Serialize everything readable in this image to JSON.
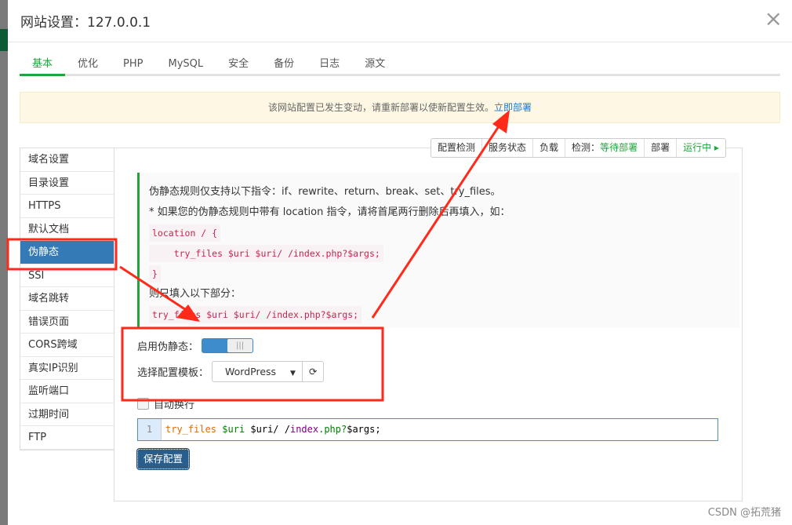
{
  "dialog": {
    "title": "网站设置：127.0.0.1",
    "close": "×"
  },
  "tabs": [
    {
      "label": "基本",
      "active": true
    },
    {
      "label": "优化"
    },
    {
      "label": "PHP"
    },
    {
      "label": "MySQL"
    },
    {
      "label": "安全"
    },
    {
      "label": "备份"
    },
    {
      "label": "日志"
    },
    {
      "label": "源文"
    }
  ],
  "notice": {
    "text": "该网站配置已发生变动，请重新部署以使新配置生效。",
    "link": "立即部署"
  },
  "sidebar": [
    "域名设置",
    "目录设置",
    "HTTPS",
    "默认文档",
    "伪静态",
    "SSI",
    "域名跳转",
    "错误页面",
    "CORS跨域",
    "真实IP识别",
    "监听端口",
    "过期时间",
    "FTP"
  ],
  "sidebar_active": "伪静态",
  "toolbar": {
    "check": "配置检测",
    "service": "服务状态",
    "load": "负载",
    "detect_label": "检测：",
    "detect_value": "等待部署",
    "deploy": "部署",
    "running": "运行中 ▸"
  },
  "info": {
    "line1": "伪静态规则仅支持以下指令：if、rewrite、return、break、set、try_files。",
    "line2": "* 如果您的伪静态规则中带有 location 指令，请将首尾两行删除后再填入，如：",
    "code1": "location / {",
    "code2": "    try_files $uri $uri/ /index.php?$args;",
    "code3": "}",
    "line3": "则只填入以下部分：",
    "code4": "try_files $uri $uri/ /index.php?$args;"
  },
  "form": {
    "enable_label": "启用伪静态：",
    "enabled": true,
    "template_label": "选择配置模板：",
    "template_value": "WordPress",
    "wrap_label": "自动换行",
    "wrap_checked": false
  },
  "editor": {
    "line_no": "1",
    "tok1": "try_files",
    "tok2": "$uri",
    "tok3": "$uri/ /",
    "tok4": "index",
    "tok5": ".php?",
    "tok6": "$args;"
  },
  "save_label": "保存配置",
  "watermark": "CSDN @拓荒猪",
  "colors": {
    "accent": "#20a53a",
    "primary": "#337ab7",
    "annotation": "#ff2a1a"
  }
}
